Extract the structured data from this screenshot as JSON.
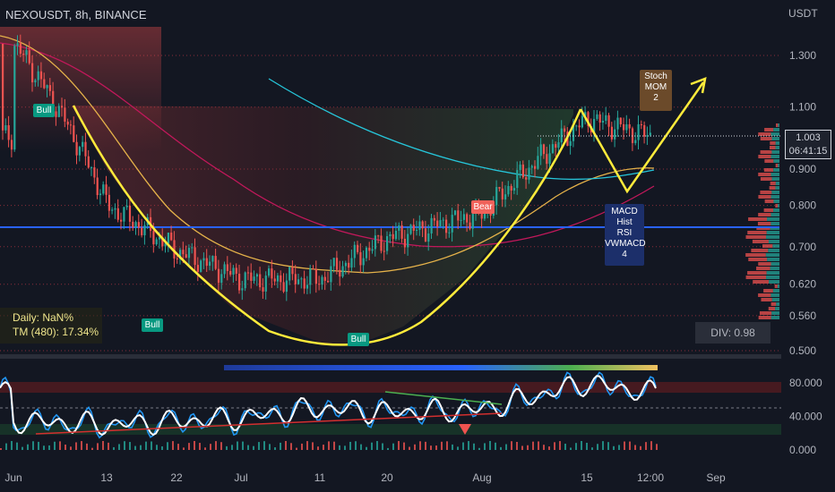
{
  "header": {
    "symbol_title": "NEXOUSDT, 8h, BINANCE",
    "currency": "USDT"
  },
  "stats": {
    "daily": "Daily: NaN%",
    "tm": "TM (480): 17.34%"
  },
  "div_label": "DIV: 0.98",
  "price_tag": {
    "price": "1.003",
    "countdown": "06:41:15"
  },
  "signals": {
    "bull": "Bull",
    "bear": "Bear"
  },
  "annotations": {
    "top": [
      "Stoch",
      "MOM",
      "2"
    ],
    "bottom": [
      "MACD",
      "Hist",
      "RSI",
      "VWMACD",
      "4"
    ]
  },
  "colors": {
    "background": "#131722",
    "bull_candle": "#26a69a",
    "bear_candle": "#ef5350",
    "cup_line": "#ffeb3b",
    "blue_line": "#2962ff",
    "ma_slow": "#26c6da",
    "ma_mid": "#e6b34a",
    "ma_pink": "#c2185b"
  },
  "chart_data": [
    {
      "type": "line",
      "title": "NEXOUSDT, 8h, BINANCE",
      "y_unit": "USDT",
      "x_ticks": [
        "Jun",
        "13",
        "22",
        "Jul",
        "11",
        "20",
        "Aug",
        "15",
        "12:00",
        "Sep"
      ],
      "y_ticks": [
        1.3,
        1.1,
        0.9,
        0.8,
        0.7,
        0.62,
        0.56,
        0.5
      ],
      "ylim": [
        0.5,
        1.42
      ],
      "log_scale": true,
      "last_price": 1.003,
      "horizontal_line": 0.75,
      "series": [
        {
          "x": [
            "Jun",
            "13",
            "22",
            "Jul",
            "11",
            "20",
            "Aug",
            "15",
            "12:00"
          ],
          "values": [
            1.35,
            0.8,
            0.69,
            0.63,
            0.63,
            0.72,
            0.78,
            1.06,
            1.0
          ]
        }
      ]
    },
    {
      "type": "line",
      "y_ticks": [
        80.0,
        40.0,
        0.0
      ],
      "ylim": [
        0,
        100
      ],
      "series": [
        {
          "x": [
            "Jun",
            "13",
            "22",
            "Jul",
            "11",
            "20",
            "Aug",
            "15",
            "12:00"
          ],
          "values": [
            35,
            30,
            34,
            38,
            50,
            45,
            48,
            80,
            68
          ]
        }
      ]
    }
  ]
}
